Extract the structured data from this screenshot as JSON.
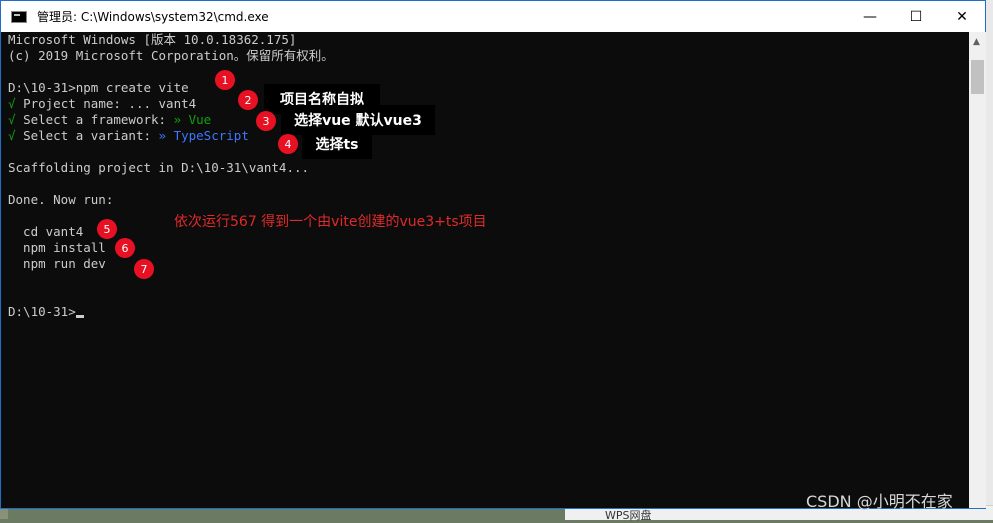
{
  "window": {
    "title": "管理员: C:\\Windows\\system32\\cmd.exe",
    "minimize": "—",
    "maximize": "☐",
    "close": "✕"
  },
  "console": {
    "lines": [
      "Microsoft Windows [版本 10.0.18362.175]",
      "(c) 2019 Microsoft Corporation。保留所有权利。",
      "D:\\10-31>npm create vite",
      "Project name: ... vant4",
      "Select a framework: ",
      "Select a variant: ",
      "Scaffolding project in D:\\10-31\\vant4...",
      "Done. Now run:",
      "  cd vant4",
      "  npm install",
      "  npm run dev",
      "D:\\10-31>"
    ],
    "check": "√",
    "framework_value": "» Vue",
    "variant_value": "» TypeScript"
  },
  "annotations": {
    "badges": [
      "1",
      "2",
      "3",
      "4",
      "5",
      "6",
      "7"
    ],
    "label_2": "项目名称自拟",
    "label_3": "选择vue 默认vue3",
    "label_4": "选择ts",
    "note": "依次运行567 得到一个由vite创建的vue3+ts项目"
  },
  "watermark": "CSDN @小明不在家",
  "background": {
    "taskbar_item": "WPS网盘"
  }
}
